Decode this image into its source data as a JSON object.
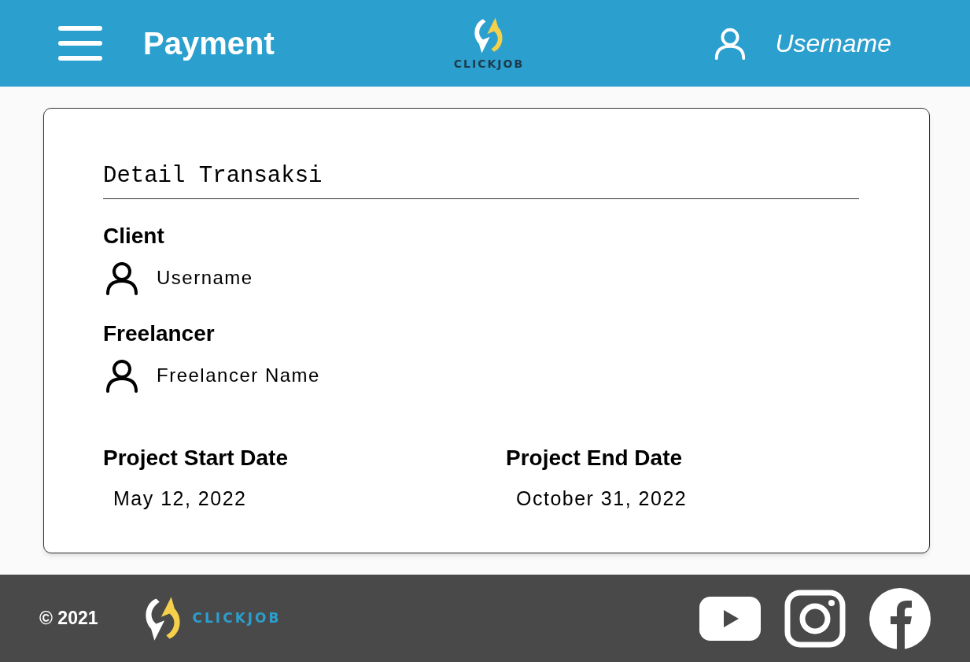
{
  "header": {
    "title": "Payment",
    "logo_text": "CLICKJOB",
    "username": "Username"
  },
  "card": {
    "title": "Detail Transaksi",
    "people": [
      {
        "label": "Client",
        "name": "Username"
      },
      {
        "label": "Freelancer",
        "name": "Freelancer Name"
      }
    ],
    "dates": [
      {
        "label": "Project Start Date",
        "value": "May 12, 2022"
      },
      {
        "label": "Project End Date",
        "value": "October 31, 2022"
      }
    ]
  },
  "footer": {
    "copyright": "© 2021",
    "logo_text": "CLICKJOB"
  }
}
